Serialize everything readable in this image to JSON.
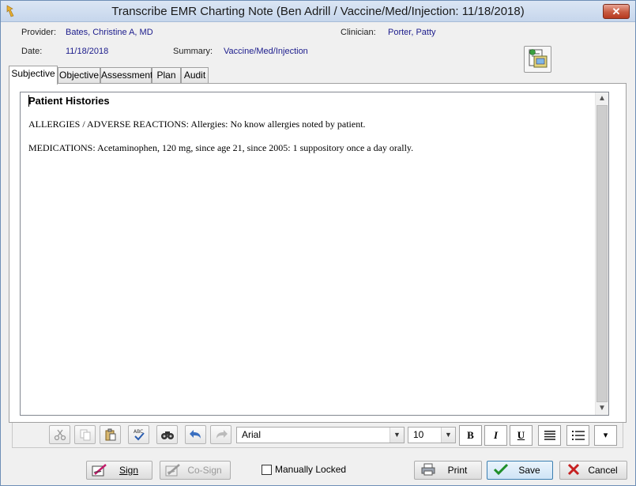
{
  "window": {
    "title": "Transcribe EMR Charting Note (Ben Adrill / Vaccine/Med/Injection: 11/18/2018)",
    "close_label": "✕"
  },
  "header": {
    "provider_label": "Provider:",
    "provider_value": "Bates, Christine A, MD",
    "clinician_label": "Clinician:",
    "clinician_value": "Porter, Patty",
    "date_label": "Date:",
    "date_value": "11/18/2018",
    "summary_label": "Summary:",
    "summary_value": "Vaccine/Med/Injection"
  },
  "tabs": [
    {
      "label": "Subjective",
      "active": true
    },
    {
      "label": "Objective",
      "active": false
    },
    {
      "label": "Assessment",
      "active": false
    },
    {
      "label": "Plan",
      "active": false
    },
    {
      "label": "Audit",
      "active": false
    }
  ],
  "editor": {
    "heading": "Patient Histories",
    "lines": [
      "ALLERGIES / ADVERSE REACTIONS:  Allergies: No know allergies noted by patient.",
      "MEDICATIONS: Acetaminophen, 120 mg, since age 21, since 2005: 1 suppository once a day orally."
    ]
  },
  "toolbar": {
    "font_name": "Arial",
    "font_size": "10",
    "bold_label": "B",
    "italic_label": "I",
    "underline_label": "U",
    "icons": [
      "cut-icon",
      "copy-icon",
      "paste-icon",
      "spellcheck-icon",
      "find-icon",
      "undo-icon",
      "redo-icon",
      "align-icon",
      "bullet-list-icon",
      "more-icon"
    ]
  },
  "footer": {
    "sign_label": "Sign",
    "cosign_label": "Co-Sign",
    "manually_locked_label": "Manually Locked",
    "print_label": "Print",
    "save_label": "Save",
    "cancel_label": "Cancel"
  },
  "colors": {
    "value_text": "#1c1c8c",
    "titlebar": "#c6d6ec",
    "close_button": "#c75a40"
  }
}
